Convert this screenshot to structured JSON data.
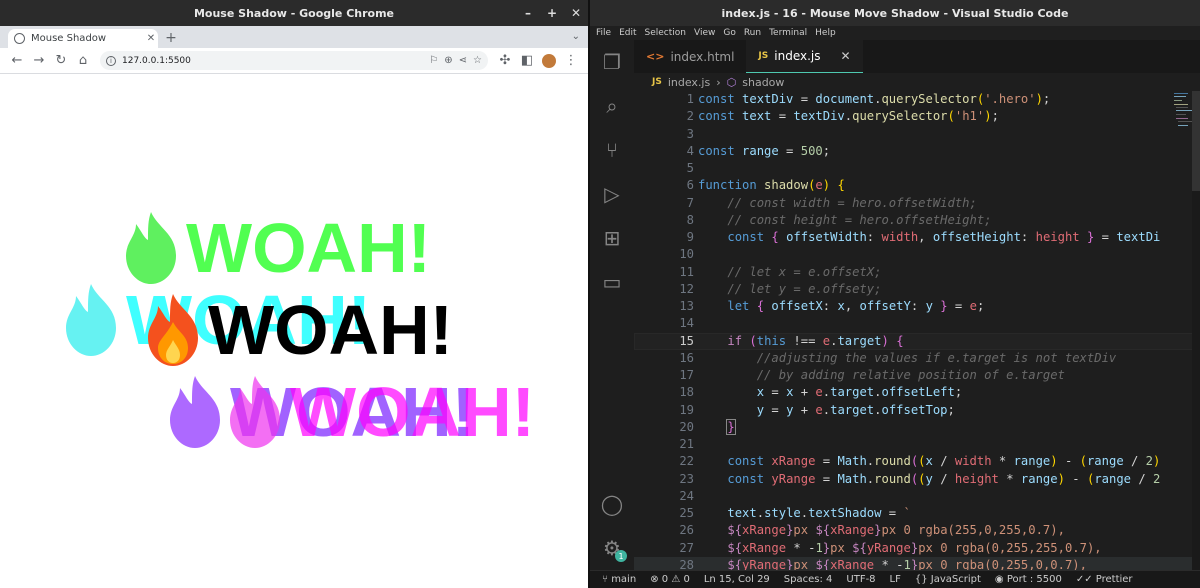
{
  "chrome": {
    "window_title": "Mouse Shadow - Google Chrome",
    "tab_title": "Mouse Shadow",
    "url": "127.0.0.1:5500",
    "page_text": "WOAH!",
    "shadow_colors": [
      "#33ff33",
      "#00ffff",
      "#7a33ff",
      "#ff00ff"
    ],
    "flame_emoji": "🔥"
  },
  "vscode": {
    "window_title": "index.js - 16 - Mouse Move Shadow - Visual Studio Code",
    "menu": [
      "File",
      "Edit",
      "Selection",
      "View",
      "Go",
      "Run",
      "Terminal",
      "Help"
    ],
    "tabs": [
      {
        "label": "index.html",
        "icon": "html-file-icon",
        "active": false
      },
      {
        "label": "index.js",
        "icon": "js-file-icon",
        "active": true
      }
    ],
    "breadcrumb": {
      "file": "index.js",
      "symbol": "shadow"
    },
    "current_line": 15,
    "lines": [
      {
        "n": "1"
      },
      {
        "n": "2"
      },
      {
        "n": "3"
      },
      {
        "n": "4"
      },
      {
        "n": "5"
      },
      {
        "n": "6"
      },
      {
        "n": "7"
      },
      {
        "n": "8"
      },
      {
        "n": "9"
      },
      {
        "n": "10"
      },
      {
        "n": "11"
      },
      {
        "n": "12"
      },
      {
        "n": "13"
      },
      {
        "n": "14"
      },
      {
        "n": "15"
      },
      {
        "n": "16"
      },
      {
        "n": "17"
      },
      {
        "n": "18"
      },
      {
        "n": "19"
      },
      {
        "n": "20"
      },
      {
        "n": "21"
      },
      {
        "n": "22"
      },
      {
        "n": "23"
      },
      {
        "n": "24"
      },
      {
        "n": "25"
      },
      {
        "n": "26"
      },
      {
        "n": "27"
      },
      {
        "n": "28"
      }
    ],
    "statusbar": {
      "branch": "main",
      "errors": "0",
      "warnings": "0",
      "position": "Ln 15, Col 29",
      "spaces": "Spaces: 4",
      "encoding": "UTF-8",
      "eol": "LF",
      "language": "JavaScript",
      "port": "Port : 5500",
      "formatter": "Prettier"
    },
    "settings_badge": "1"
  }
}
